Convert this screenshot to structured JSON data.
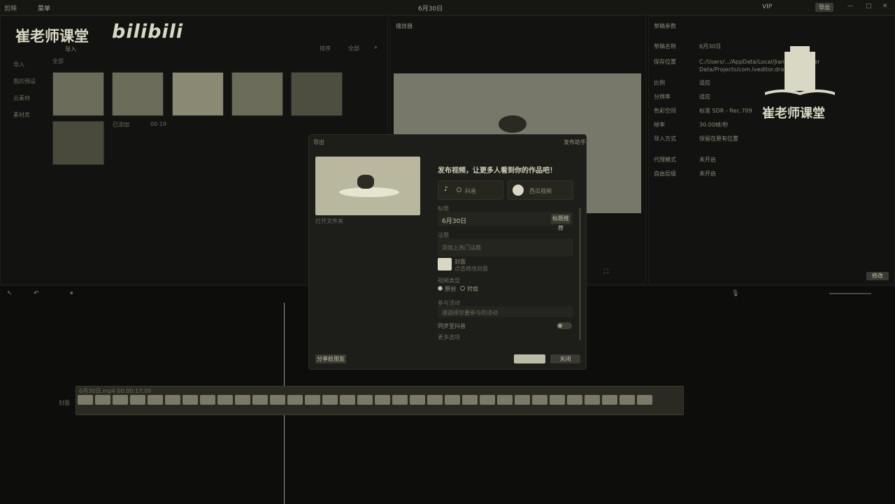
{
  "app": {
    "name": "剪映",
    "menu": "菜单",
    "project_title": "6月30日",
    "export_label": "导出"
  },
  "watermark": {
    "left_text": "崔老师课堂",
    "brand": "bilibili",
    "right_text": "崔老师课堂"
  },
  "media": {
    "toolbar": [
      "导入"
    ],
    "sidebar": [
      "导入",
      "我的预设",
      "云素材",
      "素材库"
    ],
    "section": "全部",
    "sort_labels": [
      "排序",
      "全部"
    ],
    "added_label": "已添加",
    "duration": "00:19"
  },
  "player": {
    "label": "播放器"
  },
  "draft_params": {
    "title": "草稿参数",
    "rows": [
      {
        "key": "草稿名称",
        "value": "6月30日"
      },
      {
        "key": "保存位置",
        "value": "C:/Users/.../AppData/Local/JianyingPro/User Data/Projects/com.lveditor.draft/6月30日"
      },
      {
        "key": "比例",
        "value": "适应"
      },
      {
        "key": "分辨率",
        "value": "适应"
      },
      {
        "key": "色彩空间",
        "value": "标准 SDR - Rec.709"
      },
      {
        "key": "帧率",
        "value": "30.00帧/秒"
      },
      {
        "key": "导入方式",
        "value": "保留在原有位置"
      },
      {
        "key": "代理模式",
        "value": "未开启"
      },
      {
        "key": "自由层级",
        "value": "未开启"
      }
    ],
    "edit_button": "修改"
  },
  "dialog": {
    "header": "导出",
    "help": "发布助手",
    "preview_caption": "打开文件夹",
    "headline": "发布视频，让更多人看到你的作品吧！",
    "platforms": [
      {
        "icon": "tiktok-icon",
        "label": "抖音"
      },
      {
        "icon": "xigua-icon",
        "label": "西瓜视频"
      }
    ],
    "title_label": "标题",
    "title_value": "6月30日",
    "title_button": "标题推荐",
    "topic_label": "话题",
    "topic_placeholder": "添加上热门话题",
    "cover_label": "封面",
    "cover_hint": "点击修改封面",
    "type_label": "视频类型",
    "type_options": [
      "原创",
      "转载"
    ],
    "activity_label": "参与活动",
    "activity_placeholder": "请选择您要参与的活动",
    "sync_label": "同步至抖音",
    "more_label": "更多选项",
    "footer_left_button": "分享给朋友",
    "footer_cancel": "",
    "footer_confirm": "关闭"
  },
  "timeline": {
    "track_label": "封面",
    "clip_label": "6月30日.mp4  00:00:17:09"
  }
}
